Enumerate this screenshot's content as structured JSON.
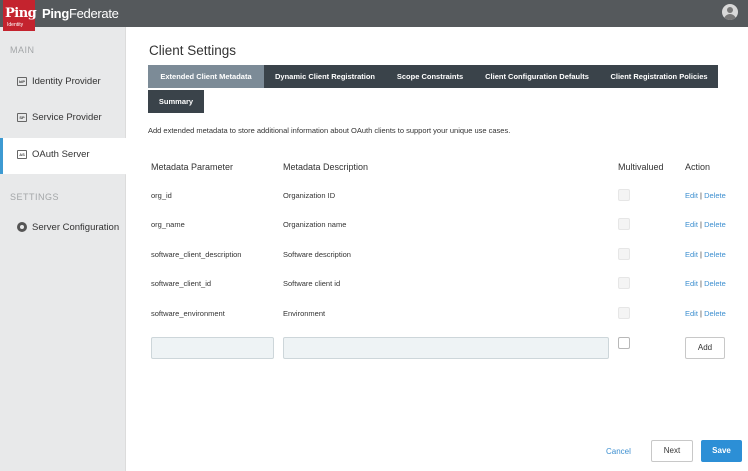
{
  "header": {
    "logo_text": "Ping",
    "logo_subtext": "Identity",
    "app_name_bold": "Ping",
    "app_name_rest": "Federate",
    "user_icon": "user-avatar-icon",
    "colors": {
      "bar": "#55595c",
      "logo": "#c4232e"
    }
  },
  "sidebar": {
    "main_label": "MAIN",
    "settings_label": "SETTINGS",
    "items": [
      {
        "label": "Identity Provider",
        "icon": "IdP",
        "active": false
      },
      {
        "label": "Service Provider",
        "icon": "SP",
        "active": false
      },
      {
        "label": "OAuth Server",
        "icon": "AS",
        "active": true
      }
    ],
    "settings_items": [
      {
        "label": "Server Configuration",
        "icon": "gear-icon"
      }
    ],
    "accent_color": "#3d9ad2"
  },
  "main": {
    "title": "Client Settings",
    "tabs": [
      {
        "label": "Extended Client Metadata",
        "active": true
      },
      {
        "label": "Dynamic Client Registration",
        "active": false
      },
      {
        "label": "Scope Constraints",
        "active": false
      },
      {
        "label": "Client Configuration Defaults",
        "active": false
      },
      {
        "label": "Client Registration Policies",
        "active": false
      },
      {
        "label": "Summary",
        "active": false
      }
    ],
    "description": "Add extended metadata to store additional information about OAuth clients to support your unique use cases.",
    "table": {
      "headers": [
        "Metadata Parameter",
        "Metadata Description",
        "Multivalued",
        "Action"
      ],
      "rows": [
        {
          "parameter": "org_id",
          "description": "Organization ID",
          "multivalued": false
        },
        {
          "parameter": "org_name",
          "description": "Organization name",
          "multivalued": false
        },
        {
          "parameter": "software_client_description",
          "description": "Software description",
          "multivalued": false
        },
        {
          "parameter": "software_client_id",
          "description": "Software client id",
          "multivalued": false
        },
        {
          "parameter": "software_environment",
          "description": "Environment",
          "multivalued": false
        }
      ],
      "edit_label": "Edit",
      "separator": "|",
      "delete_label": "Delete",
      "new_parameter_value": "",
      "new_description_value": "",
      "add_label": "Add"
    },
    "footer": {
      "cancel_label": "Cancel",
      "next_label": "Next",
      "save_label": "Save",
      "primary_color": "#2c8fd6"
    }
  }
}
